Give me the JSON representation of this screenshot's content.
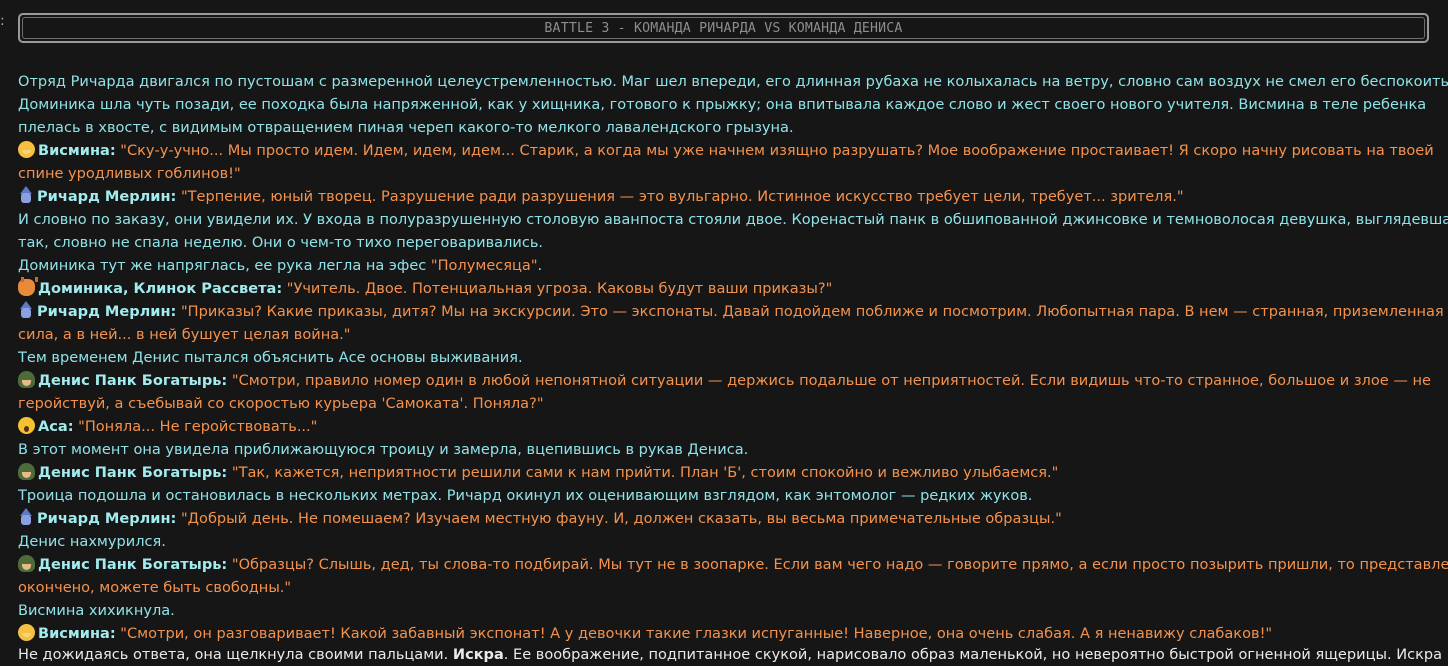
{
  "title": "BATTLE 3 - КОМАНДА РИЧАРДА VS КОМАНДА ДЕНИСА",
  "side_mark": ":",
  "lines": [
    {
      "type": "nar",
      "text": "Отряд Ричарда двигался по пустошам с размеренной целеустремленностью. Маг шел впереди, его длинная рубаха не колыхалась на ветру, словно сам воздух не смел его беспокоить."
    },
    {
      "type": "nar",
      "text": "Доминика шла чуть позади, ее походка была напряженной, как у хищника, готового к прыжку; она впитывала каждое слово и жест своего нового учителя. Висмина в теле ребенка"
    },
    {
      "type": "nar",
      "text": "плелась в хвосте, с видимым отвращением пиная череп какого-то мелкого лавалендского грызуна."
    },
    {
      "type": "spk",
      "icon": "vismina-emoji-icon",
      "speaker": "Висмина:",
      "quote": "\"Ску-у-учно... Мы просто идем. Идем, идем, идем... Старик, а когда мы уже начнем изящно разрушать? Мое воображение простаивает! Я скоро начну рисовать на твоей"
    },
    {
      "type": "quote",
      "text": "спине уродливых гоблинов!\""
    },
    {
      "type": "spk",
      "icon": "wizard-emoji-icon",
      "speaker": "Ричард Мерлин:",
      "quote": "\"Терпение, юный творец. Разрушение ради разрушения — это вульгарно. Истинное искусство требует цели, требует... зрителя.\""
    },
    {
      "type": "nar",
      "text": "И словно по заказу, они увидели их. У входа в полуразрушенную столовую аванпоста стояли двое. Коренастый панк в обшипованной джинсовке и темноволосая девушка, выглядевшая"
    },
    {
      "type": "nar",
      "text": "так, словно не спала неделю. Они о чем-то тихо переговаривались."
    },
    {
      "type": "mix",
      "text": "Доминика тут же напряглась, ее рука легла на эфес ",
      "quote": "\"Полумесяца\"",
      "tail": "."
    },
    {
      "type": "spk",
      "icon": "cat-emoji-icon",
      "speaker": "Доминика, Клинок Рассвета:",
      "quote": "\"Учитель. Двое. Потенциальная угроза. Каковы будут ваши приказы?\""
    },
    {
      "type": "spk",
      "icon": "wizard-emoji-icon",
      "speaker": "Ричард Мерлин:",
      "quote": "\"Приказы? Какие приказы, дитя? Мы на экскурсии. Это — экспонаты. Давай подойдем поближе и посмотрим. Любопытная пара. В нем — странная, приземленная"
    },
    {
      "type": "quote",
      "text": "сила, а в ней... в ней бушует целая война.\""
    },
    {
      "type": "nar",
      "text": "Тем временем Денис пытался объяснить Асе основы выживания."
    },
    {
      "type": "spk",
      "icon": "soldier-helmet-emoji-icon",
      "speaker": "Денис Панк Богатырь:",
      "quote": "\"Смотри, правило номер один в любой непонятной ситуации — держись подальше от неприятностей. Если видишь что-то странное, большое и злое — не"
    },
    {
      "type": "quote",
      "text": "геройствуй, а съебывай со скоростью курьера 'Самоката'. Поняла?\""
    },
    {
      "type": "spk",
      "icon": "scared-face-emoji-icon",
      "speaker": "Аса:",
      "quote": "\"Поняла... Не геройствовать...\""
    },
    {
      "type": "nar",
      "text": "В этот момент она увидела приближающуюся троицу и замерла, вцепившись в рукав Дениса."
    },
    {
      "type": "spk",
      "icon": "soldier-helmet-emoji-icon",
      "speaker": "Денис Панк Богатырь:",
      "quote": "\"Так, кажется, неприятности решили сами к нам прийти. План 'Б', стоим спокойно и вежливо улыбаемся.\""
    },
    {
      "type": "nar",
      "text": "Троица подошла и остановилась в нескольких метрах. Ричард окинул их оценивающим взглядом, как энтомолог — редких жуков."
    },
    {
      "type": "spk",
      "icon": "wizard-emoji-icon",
      "speaker": "Ричард Мерлин:",
      "quote": "\"Добрый день. Не помешаем? Изучаем местную фауну. И, должен сказать, вы весьма примечательные образцы.\""
    },
    {
      "type": "nar",
      "text": "Денис нахмурился."
    },
    {
      "type": "spk",
      "icon": "soldier-helmet-emoji-icon",
      "speaker": "Денис Панк Богатырь:",
      "quote": "\"Образцы? Слышь, дед, ты слова-то подбирай. Мы тут не в зоопарке. Если вам чего надо — говорите прямо, а если просто позырить пришли, то представление"
    },
    {
      "type": "quote",
      "text": "окончено, можете быть свободны.\""
    },
    {
      "type": "nar",
      "text": "Висмина хихикнула."
    },
    {
      "type": "spk",
      "icon": "vismina-emoji-icon",
      "speaker": "Висмина:",
      "quote": "\"Смотри, он разговаривает! Какой забавный экспонат! А у девочки такие глазки испуганные! Наверное, она очень слабая. А я ненавижу слабаков!\""
    }
  ],
  "cut_line": {
    "a": "Не дожидаясь ответа, она щелкнула своими пальцами. ",
    "b": "Искра",
    "c": ". Ее воображение, подпитанное скукой, нарисовало образ маленькой, но невероятно быстрой огненной ящерицы. Искра"
  }
}
